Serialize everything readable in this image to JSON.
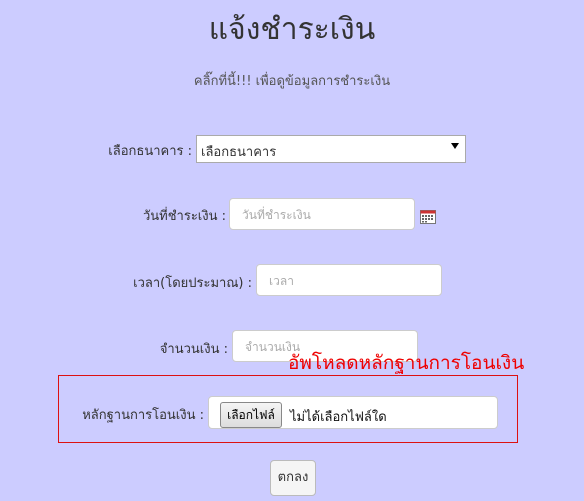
{
  "page": {
    "title": "แจ้งชำระเงิน",
    "subtitle": "คลิ๊กที่นี้!!! เพื่อดูข้อมูลการชำระเงิน"
  },
  "form": {
    "bank": {
      "label": "เลือกธนาคาร :",
      "selected": "เลือกธนาคาร"
    },
    "date": {
      "label": "วันที่ชำระเงิน :",
      "placeholder": "วันที่ชำระเงิน"
    },
    "time": {
      "label": "เวลา(โดยประมาณ) :",
      "placeholder": "เวลา"
    },
    "amount": {
      "label": "จำนวนเงิน :",
      "placeholder": "จำนวนเงิน"
    },
    "proof": {
      "label": "หลักฐานการโอนเงิน :",
      "button_label": "เลือกไฟล์",
      "status": "ไม่ได้เลือกไฟล์ใด"
    },
    "submit_label": "ตกลง"
  },
  "annotation": {
    "text": "อัพโหลดหลักฐานการโอนเงิน",
    "color": "#ee0000"
  },
  "colors": {
    "background": "#ccccff",
    "highlight_border": "#dd1111"
  },
  "icons": {
    "calendar": "calendar-icon",
    "dropdown": "chevron-down-icon"
  }
}
